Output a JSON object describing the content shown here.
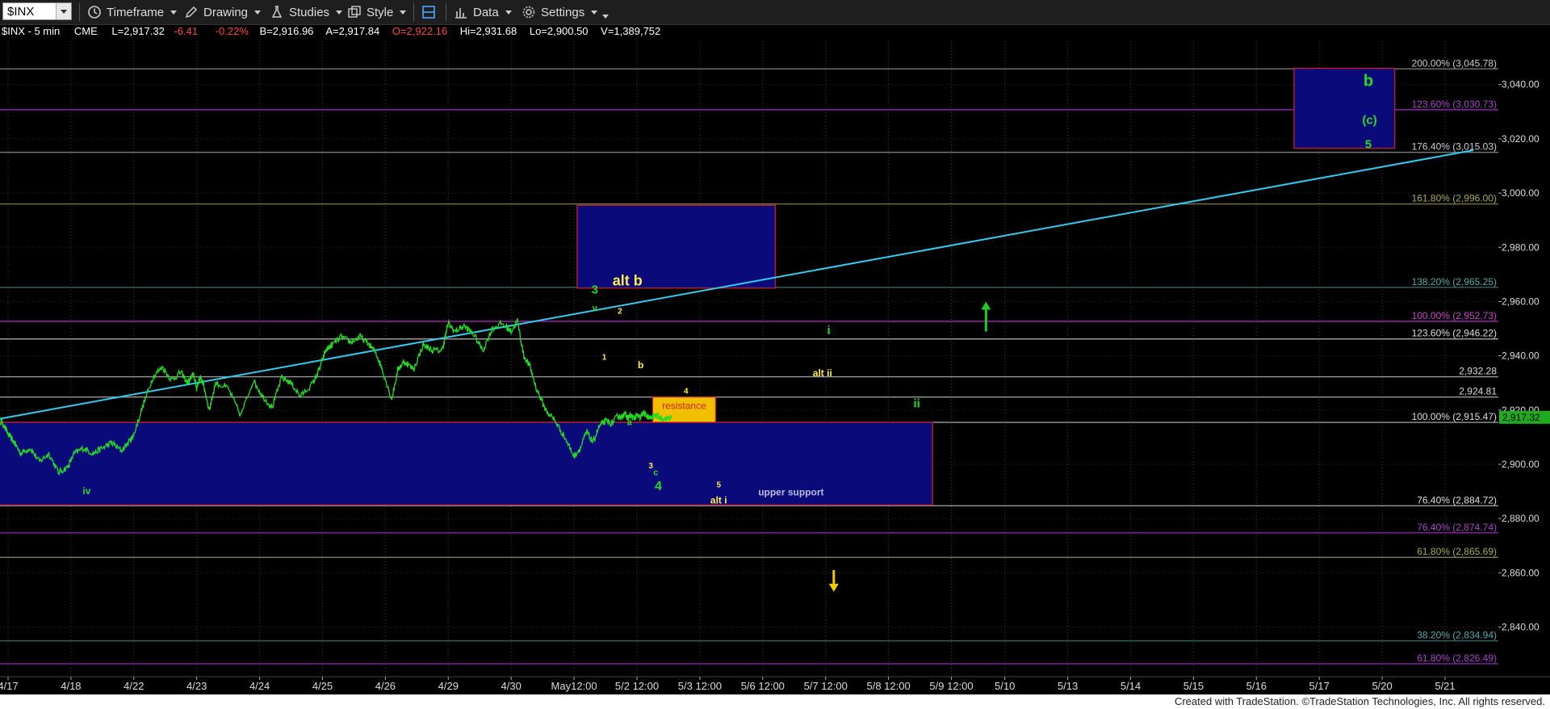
{
  "toolbar": {
    "symbol": "$INX",
    "items": [
      {
        "label": "Timeframe",
        "icon": "clock-icon"
      },
      {
        "label": "Drawing",
        "icon": "pencil-icon"
      },
      {
        "label": "Studies",
        "icon": "flask-icon"
      },
      {
        "label": "Style",
        "icon": "style-icon"
      },
      {
        "label": "",
        "icon": "layout-icon"
      },
      {
        "label": "Data",
        "icon": "bar-chart-icon"
      },
      {
        "label": "Settings",
        "icon": "gear-icon"
      }
    ]
  },
  "header": {
    "title": "$INX - 5 min",
    "exchange": "CME",
    "last": "L=2,917.32",
    "change": "-6.41",
    "change_pct": "-0.22%",
    "bid": "B=2,916.96",
    "ask": "A=2,917.84",
    "open": "O=2,922.16",
    "high": "Hi=2,931.68",
    "low": "Lo=2,900.50",
    "volume": "V=1,389,752"
  },
  "colors": {
    "background": "#000000",
    "price_line": "#22dd22",
    "trend_line": "#33ccee",
    "box_fill": "#0a0a7a",
    "box_border": "#aa2233",
    "resistance_fill": "#f0c000",
    "up_arrow": "#22cc22",
    "down_arrow": "#eecc00"
  },
  "chart_data": {
    "type": "line",
    "title": "$INX - 5 min",
    "ylim": [
      2822,
      3056
    ],
    "y_ticks": [
      2840,
      2860,
      2880,
      2900,
      2920,
      2940,
      2960,
      2980,
      3000,
      3020,
      3040
    ],
    "y_tick_labels": [
      "2,840.00",
      "2,860.00",
      "2,880.00",
      "2,900.00",
      "2,920.00",
      "2,940.00",
      "2,960.00",
      "2,980.00",
      "3,000.00",
      "3,020.00",
      "3,040.00"
    ],
    "x_tick_labels": [
      "4/17",
      "4/18",
      "4/22",
      "4/23",
      "4/24",
      "4/25",
      "4/26",
      "4/29",
      "4/30",
      "May12:00",
      "5/2 12:00",
      "5/3 12:00",
      "5/6 12:00",
      "5/7 12:00",
      "5/8 12:00",
      "5/9 12:00",
      "5/10",
      "5/13",
      "5/14",
      "5/15",
      "5/16",
      "5/17",
      "5/20",
      "5/21"
    ],
    "x_tick_index": [
      0.0,
      1.0,
      2.0,
      3.0,
      4.0,
      5.0,
      6.0,
      7.0,
      8.0,
      9.0,
      10.0,
      11.0,
      12.0,
      13.0,
      14.0,
      15.0,
      15.85,
      16.85,
      17.85,
      18.85,
      19.85,
      20.85,
      21.85,
      22.85
    ],
    "x_range": [
      -0.2,
      23.4
    ],
    "last_price": 2917.32,
    "last_price_label": "2,917.32",
    "series": [
      {
        "x": [
          -0.2,
          -0.1,
          0.0,
          0.1,
          0.2,
          0.35,
          0.5,
          0.65,
          0.8,
          0.95,
          1.05,
          1.2,
          1.35,
          1.5,
          1.65,
          1.8,
          1.95,
          2.0,
          2.15,
          2.3,
          2.45,
          2.6,
          2.75,
          2.85,
          2.95,
          3.0,
          3.05,
          3.1,
          3.2,
          3.3,
          3.5,
          3.7,
          3.9,
          4.05,
          4.2,
          4.35,
          4.5,
          4.65,
          4.85,
          4.95,
          5.05,
          5.15,
          5.3,
          5.45,
          5.6,
          5.75,
          5.85,
          5.95,
          6.1,
          6.2,
          6.3,
          6.45,
          6.6,
          6.75,
          6.9,
          7.0,
          7.1,
          7.25,
          7.4,
          7.55,
          7.7,
          7.85,
          8.0,
          8.1,
          8.2,
          8.3,
          8.4,
          8.55,
          8.7,
          8.85,
          9.0,
          9.1,
          9.2,
          9.3,
          9.4,
          9.5,
          9.6,
          9.7,
          9.75,
          9.8,
          9.85,
          9.9,
          9.95,
          10.0,
          10.05,
          10.1,
          10.15,
          10.2,
          10.3,
          10.4,
          10.5,
          10.55
        ],
        "y": [
          2913,
          2916,
          2911,
          2908,
          2904,
          2906,
          2901,
          2904,
          2897,
          2899,
          2904,
          2906,
          2904,
          2906,
          2908,
          2905,
          2909,
          2911,
          2922,
          2932,
          2936,
          2931,
          2934,
          2930,
          2933,
          2928,
          2932,
          2930,
          2920,
          2930,
          2928,
          2918,
          2931,
          2925,
          2921,
          2932,
          2930,
          2925,
          2930,
          2935,
          2942,
          2944,
          2947,
          2945,
          2947,
          2944,
          2941,
          2935,
          2924,
          2935,
          2938,
          2935,
          2944,
          2942,
          2942,
          2952,
          2949,
          2951,
          2948,
          2942,
          2950,
          2952,
          2949,
          2953,
          2940,
          2936,
          2928,
          2920,
          2916,
          2910,
          2903,
          2906,
          2912,
          2908,
          2914,
          2916,
          2915,
          2918,
          2917,
          2919,
          2917,
          2918,
          2917,
          2918,
          2917,
          2919,
          2918,
          2917,
          2918,
          2917,
          2917,
          2917.3
        ]
      }
    ],
    "fib_levels": [
      {
        "price": 3045.78,
        "label": "200.00% (3,045.78)",
        "line_color": "#777777",
        "text_color": "#cccccc"
      },
      {
        "price": 3030.73,
        "label": "123.60% (3,030.73)",
        "line_color": "#8822aa",
        "text_color": "#aa44cc"
      },
      {
        "price": 3015.03,
        "label": "176.40% (3,015.03)",
        "line_color": "#777777",
        "text_color": "#cccccc"
      },
      {
        "price": 2996.0,
        "label": "161.80% (2,996.00)",
        "line_color": "#777744",
        "text_color": "#aaaa55"
      },
      {
        "price": 2965.25,
        "label": "138.20% (2,965.25)",
        "line_color": "#336666",
        "text_color": "#55aaaa"
      },
      {
        "price": 2952.73,
        "label": "100.00% (2,952.73)",
        "line_color": "#9922aa",
        "text_color": "#cc44cc"
      },
      {
        "price": 2946.22,
        "label": "123.60% (2,946.22)",
        "line_color": "#999999",
        "text_color": "#dddddd"
      },
      {
        "price": 2932.28,
        "label": "2,932.28",
        "line_color": "#999999",
        "text_color": "#dddddd"
      },
      {
        "price": 2924.81,
        "label": "2,924.81",
        "line_color": "#999999",
        "text_color": "#dddddd"
      },
      {
        "price": 2915.47,
        "label": "100.00% (2,915.47)",
        "line_color": "#999999",
        "text_color": "#dddddd"
      },
      {
        "price": 2884.72,
        "label": "76.40% (2,884.72)",
        "line_color": "#999999",
        "text_color": "#dddddd"
      },
      {
        "price": 2874.74,
        "label": "76.40% (2,874.74)",
        "line_color": "#8822aa",
        "text_color": "#aa44cc"
      },
      {
        "price": 2865.69,
        "label": "61.80% (2,865.69)",
        "line_color": "#777744",
        "text_color": "#aaaa55"
      },
      {
        "price": 2834.94,
        "label": "38.20% (2,834.94)",
        "line_color": "#336666",
        "text_color": "#55aaaa"
      },
      {
        "price": 2826.49,
        "label": "61.80% (2,826.49)",
        "line_color": "#8822aa",
        "text_color": "#aa44cc"
      }
    ],
    "trend_line": {
      "x1": -0.2,
      "y1": 2916.5,
      "x2": 23.3,
      "y2": 3015.8
    },
    "boxes": [
      {
        "x1": -0.2,
        "x2": 14.7,
        "y_top": 2915.5,
        "y_bottom": 2885.0,
        "name": "upper-support-box"
      },
      {
        "x1": 9.05,
        "x2": 12.2,
        "y_top": 2995.5,
        "y_bottom": 2965.0,
        "name": "alt-b-box"
      },
      {
        "x1": 20.45,
        "x2": 22.05,
        "y_top": 3046.0,
        "y_bottom": 3016.5,
        "name": "target-box"
      }
    ],
    "resistance": {
      "x1": 10.25,
      "x2": 11.25,
      "y_top": 2924.8,
      "y_bottom": 2915.5,
      "label": "resistance"
    },
    "annotations": [
      {
        "text": "iv",
        "x": 1.25,
        "y": 2889,
        "color": "#22dd22",
        "size": 12
      },
      {
        "text": "3",
        "x": 9.33,
        "y": 2963,
        "color": "#22dd22",
        "size": 15
      },
      {
        "text": "v",
        "x": 9.33,
        "y": 2956.5,
        "color": "#22dd22",
        "size": 11
      },
      {
        "text": "alt b",
        "x": 9.85,
        "y": 2966,
        "color": "#ffee44",
        "size": 18
      },
      {
        "text": "2",
        "x": 9.73,
        "y": 2955.5,
        "color": "#ffee44",
        "size": 10
      },
      {
        "text": "1",
        "x": 9.48,
        "y": 2938.5,
        "color": "#ffee44",
        "size": 10
      },
      {
        "text": "b",
        "x": 10.06,
        "y": 2935.5,
        "color": "#ffee44",
        "size": 12
      },
      {
        "text": "a",
        "x": 9.88,
        "y": 2914.5,
        "color": "#22dd22",
        "size": 11
      },
      {
        "text": "3",
        "x": 10.22,
        "y": 2898.5,
        "color": "#ffee44",
        "size": 10
      },
      {
        "text": "c",
        "x": 10.3,
        "y": 2896,
        "color": "#22dd22",
        "size": 11
      },
      {
        "text": "4",
        "x": 10.34,
        "y": 2890.5,
        "color": "#22dd22",
        "size": 16
      },
      {
        "text": "4",
        "x": 10.78,
        "y": 2926,
        "color": "#ffee44",
        "size": 10
      },
      {
        "text": "5",
        "x": 11.3,
        "y": 2891.5,
        "color": "#ffee44",
        "size": 10
      },
      {
        "text": "alt i",
        "x": 11.3,
        "y": 2885.5,
        "color": "#ffee44",
        "size": 12
      },
      {
        "text": "upper support",
        "x": 12.45,
        "y": 2888.5,
        "color": "#bbbbdd",
        "size": 12
      },
      {
        "text": "i",
        "x": 13.05,
        "y": 2948,
        "color": "#22dd22",
        "size": 15
      },
      {
        "text": "alt ii",
        "x": 12.95,
        "y": 2932.5,
        "color": "#ffee44",
        "size": 12
      },
      {
        "text": "ii",
        "x": 14.45,
        "y": 2921,
        "color": "#22dd22",
        "size": 15
      },
      {
        "text": "b",
        "x": 21.63,
        "y": 3039.5,
        "color": "#22dd22",
        "size": 20
      },
      {
        "text": "(c)",
        "x": 21.65,
        "y": 3025.5,
        "color": "#22dd22",
        "size": 15
      },
      {
        "text": "5",
        "x": 21.63,
        "y": 3016.5,
        "color": "#22dd22",
        "size": 15
      }
    ],
    "arrows": [
      {
        "direction": "up",
        "x": 15.55,
        "y_tail": 2949,
        "y_head": 2960,
        "color": "#22cc22"
      },
      {
        "direction": "down",
        "x": 13.13,
        "y_tail": 2861,
        "y_head": 2853,
        "color": "#eecc00"
      }
    ]
  },
  "footer": {
    "credit": "Created with TradeStation. ©TradeStation Technologies, Inc. All rights reserved."
  }
}
